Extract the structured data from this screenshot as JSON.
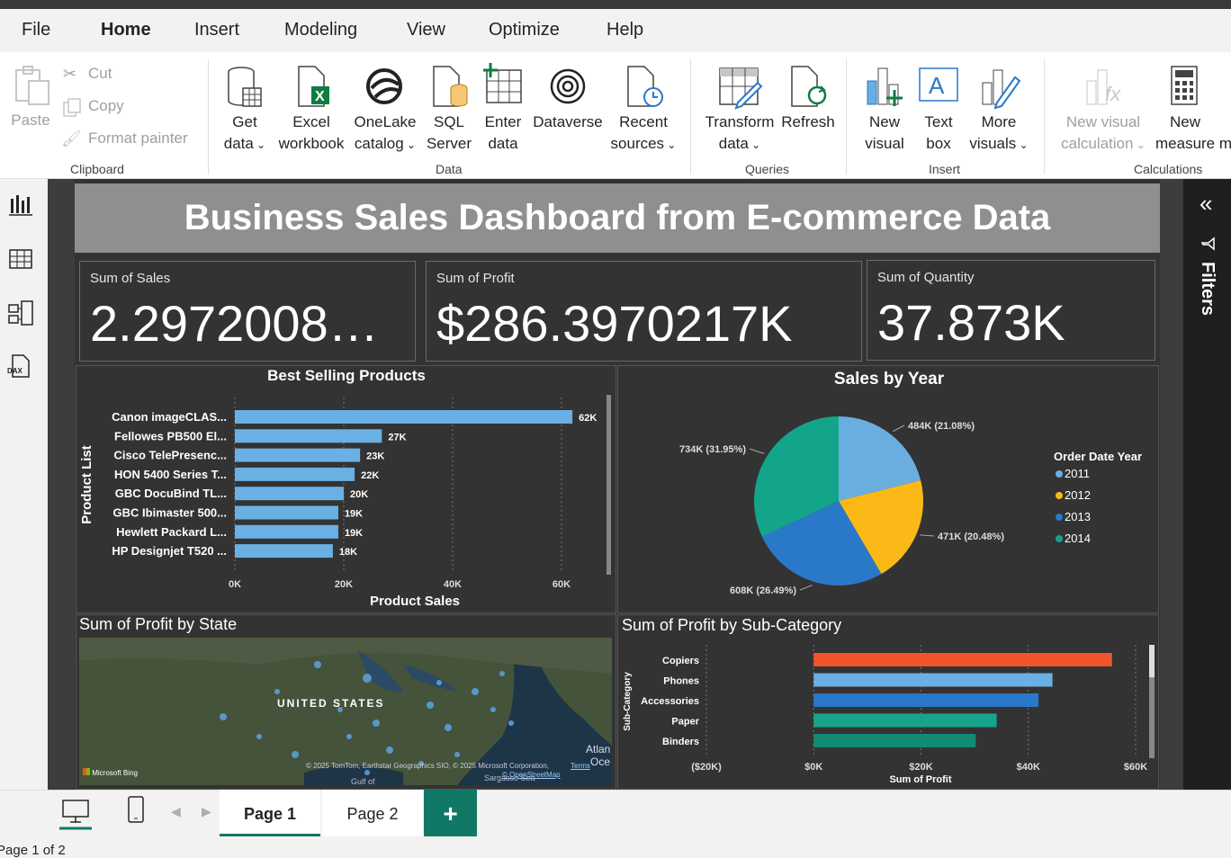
{
  "ribbon_tabs": [
    "File",
    "Home",
    "Insert",
    "Modeling",
    "View",
    "Optimize",
    "Help"
  ],
  "clipboard": {
    "paste": "Paste",
    "cut": "Cut",
    "copy": "Copy",
    "format_painter": "Format painter",
    "group": "Clipboard"
  },
  "data_group": {
    "get_data": [
      "Get",
      "data"
    ],
    "excel": [
      "Excel",
      "workbook"
    ],
    "onelake": [
      "OneLake",
      "catalog"
    ],
    "sql": [
      "SQL",
      "Server"
    ],
    "enter": [
      "Enter",
      "data"
    ],
    "dataverse": "Dataverse",
    "recent": [
      "Recent",
      "sources"
    ],
    "group": "Data"
  },
  "queries_group": {
    "transform": [
      "Transform",
      "data"
    ],
    "refresh": "Refresh",
    "group": "Queries"
  },
  "insert_group": {
    "new_visual": [
      "New",
      "visual"
    ],
    "text_box": [
      "Text",
      "box"
    ],
    "more_visuals": [
      "More",
      "visuals"
    ],
    "group": "Insert"
  },
  "calc_group": {
    "new_visual_calc": [
      "New visual",
      "calculation"
    ],
    "new_measure": [
      "New",
      "measure m"
    ],
    "group": "Calculations"
  },
  "report": {
    "title": "Business Sales Dashboard from E-commerce Data",
    "cards": [
      {
        "label": "Sum of Sales",
        "value": "2.2972008…"
      },
      {
        "label": "Sum of Profit",
        "value": "$286.3970217K"
      },
      {
        "label": "Sum of Quantity",
        "value": "37.873K"
      }
    ],
    "map_title": "Sum of Profit by State",
    "map_label": "UNITED STATES",
    "map_credit": "© 2025 TomTom, Earthstar Geographics SIO, © 2025 Microsoft Corporation,",
    "map_terms": "Terms",
    "map_osm": "© OpenStreetMap",
    "map_bing": "Microsoft Bing",
    "map_atl": "Atlan",
    "map_oce": "Oce",
    "map_gulf": "Gulf of",
    "map_sarg": "Sargasso Sea"
  },
  "filters_label": "Filters",
  "pages": [
    "Page 1",
    "Page 2"
  ],
  "add_page": "+",
  "status": "Page 1 of 2",
  "colors": {
    "accent": "#117865",
    "bar": "#6ab0e4",
    "y2011": "#6aaee0",
    "y2012": "#fbb917",
    "y2013": "#2a78c8",
    "y2014": "#12a58a",
    "copiers": "#f0552b",
    "teal": "#16a58b"
  },
  "chart_data": [
    {
      "type": "bar",
      "title": "Best Selling Products",
      "xlabel": "Product Sales",
      "ylabel": "Product List",
      "categories": [
        "Canon imageCLAS...",
        "Fellowes PB500 El...",
        "Cisco TelePresenc...",
        "HON 5400 Series T...",
        "GBC DocuBind TL...",
        "GBC Ibimaster 500...",
        "Hewlett Packard L...",
        "HP Designjet T520 ..."
      ],
      "values": [
        62000,
        27000,
        23000,
        22000,
        20000,
        19000,
        19000,
        18000
      ],
      "data_labels": [
        "62K",
        "27K",
        "23K",
        "22K",
        "20K",
        "19K",
        "19K",
        "18K"
      ],
      "xticks": [
        "0K",
        "20K",
        "40K",
        "60K"
      ],
      "xlim": [
        0,
        60000
      ]
    },
    {
      "type": "pie",
      "title": "Sales by Year",
      "legend_title": "Order Date Year",
      "categories": [
        "2011",
        "2012",
        "2013",
        "2014"
      ],
      "values": [
        484000,
        471000,
        608000,
        734000
      ],
      "data_labels": [
        "484K (21.08%)",
        "471K (20.48%)",
        "608K (26.49%)",
        "734K (31.95%)"
      ],
      "percent": [
        21.08,
        20.48,
        26.49,
        31.95
      ]
    },
    {
      "type": "bar",
      "title": "Sum of Profit by Sub-Category",
      "xlabel": "Sum of Profit",
      "ylabel": "Sub-Category",
      "categories": [
        "Copiers",
        "Phones",
        "Accessories",
        "Paper",
        "Binders"
      ],
      "values": [
        55600,
        44500,
        41900,
        34100,
        30200
      ],
      "xticks": [
        "($20K)",
        "$0K",
        "$20K",
        "$40K",
        "$60K"
      ],
      "xlim": [
        -20000,
        60000
      ]
    }
  ]
}
